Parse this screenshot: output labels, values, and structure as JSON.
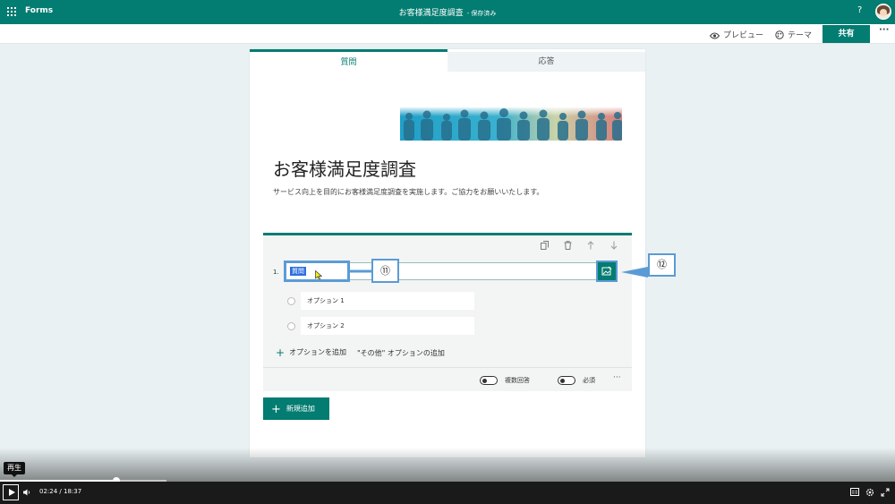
{
  "topbar": {
    "app_name": "Forms",
    "doc_title": "お客様満足度調査",
    "saved_status": "- 保存済み",
    "help": "?"
  },
  "subbar": {
    "preview": "プレビュー",
    "theme": "テーマ",
    "share": "共有",
    "more": "···"
  },
  "tabs": [
    {
      "label": "質問"
    },
    {
      "label": "応答"
    }
  ],
  "form": {
    "title": "お客様満足度調査",
    "description": "サービス向上を目的にお客様満足度調査を実施します。ご協力をお願いいたします。"
  },
  "question": {
    "number": "1.",
    "title_selected": "質問",
    "options": [
      "オプション 1",
      "オプション 2"
    ],
    "add_option": "オプションを追加",
    "add_other": "\"その他\" オプションの追加",
    "multiple_answers": "複数回答",
    "required": "必須",
    "more": "···"
  },
  "callouts": {
    "c11": "⑪",
    "c12": "⑫"
  },
  "new_button": "新規追加",
  "player": {
    "tooltip": "再生",
    "current_time": "02:24",
    "separator": "/",
    "duration": "18:37",
    "progress": 0.13
  },
  "colors": {
    "accent": "#037c71",
    "callout": "#5b9bd5",
    "selection": "#2d6ee0"
  }
}
